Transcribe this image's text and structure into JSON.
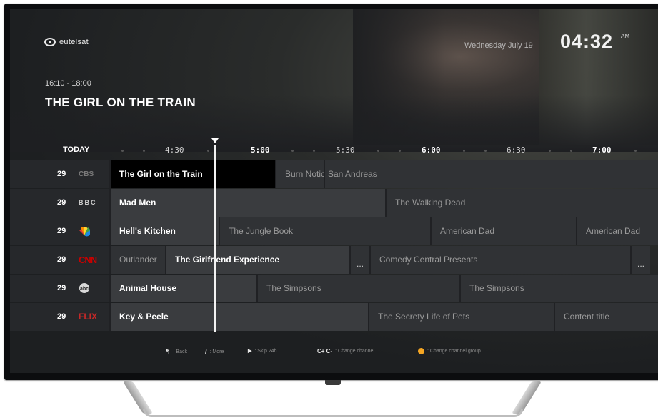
{
  "brand": {
    "name": "eutelsat",
    "icon": "eutelsat-logo-icon"
  },
  "clock": {
    "date": "Wednesday July 19",
    "time": "04:32",
    "ampm": "AM"
  },
  "program": {
    "time_range": "16:10 - 18:00",
    "title": "THE GIRL ON THE TRAIN"
  },
  "timeline": {
    "today_label": "TODAY",
    "slots": [
      {
        "label": "4:30",
        "bold": false
      },
      {
        "label": "5:00",
        "bold": true
      },
      {
        "label": "5:30",
        "bold": false
      },
      {
        "label": "6:00",
        "bold": true
      },
      {
        "label": "6:30",
        "bold": false
      },
      {
        "label": "7:00",
        "bold": true
      }
    ]
  },
  "channels": [
    {
      "number": "29",
      "logo": "CBS",
      "logo_icon": "cbs-logo-icon",
      "programs": [
        {
          "title": "The Girl on the Train",
          "state": "selected"
        },
        {
          "title": "Burn Notice",
          "state": "normal"
        },
        {
          "title": "San Andreas",
          "state": "normal"
        }
      ]
    },
    {
      "number": "29",
      "logo": "BBC",
      "logo_icon": "bbc-logo-icon",
      "programs": [
        {
          "title": "Mad Men",
          "state": "current"
        },
        {
          "title": "The Walking Dead",
          "state": "normal"
        }
      ]
    },
    {
      "number": "29",
      "logo": "NBC",
      "logo_icon": "nbc-peacock-icon",
      "programs": [
        {
          "title": "Hell's Kitchen",
          "state": "current"
        },
        {
          "title": "The Jungle Book",
          "state": "normal"
        },
        {
          "title": "American Dad",
          "state": "normal"
        },
        {
          "title": "American Dad",
          "state": "normal"
        }
      ]
    },
    {
      "number": "29",
      "logo": "CNN",
      "logo_icon": "cnn-logo-icon",
      "programs": [
        {
          "title": "Outlander",
          "state": "normal"
        },
        {
          "title": "The Girlfriend Experience",
          "state": "current"
        },
        {
          "title": "...",
          "state": "more"
        },
        {
          "title": "Comedy Central Presents",
          "state": "normal"
        },
        {
          "title": "...",
          "state": "more"
        }
      ]
    },
    {
      "number": "29",
      "logo": "abc",
      "logo_icon": "abc-logo-icon",
      "programs": [
        {
          "title": "Animal House",
          "state": "current"
        },
        {
          "title": "The Simpsons",
          "state": "normal"
        },
        {
          "title": "The Simpsons",
          "state": "normal"
        }
      ]
    },
    {
      "number": "29",
      "logo": "FLIX",
      "logo_icon": "flix-logo-icon",
      "programs": [
        {
          "title": "Key & Peele",
          "state": "current"
        },
        {
          "title": "The Secrety Life of Pets",
          "state": "normal"
        },
        {
          "title": "Content title",
          "state": "normal"
        }
      ]
    }
  ],
  "hints": [
    {
      "key": "↰",
      "text": ": Back",
      "icon": "back-arrow-icon"
    },
    {
      "key": "i",
      "text": ": More",
      "icon": "info-icon"
    },
    {
      "key": "▶",
      "text": ": Skip 24h",
      "icon": "skip-icon"
    },
    {
      "key": "C+ C-",
      "text": ": Change channel",
      "icon": "channel-icon"
    },
    {
      "key": "",
      "text": ": Change channel group",
      "icon": "yellow-button-icon"
    }
  ],
  "colors": {
    "accent_yellow": "#f5a623",
    "cnn_red": "#cc0000",
    "selected_bg": "#000000"
  }
}
